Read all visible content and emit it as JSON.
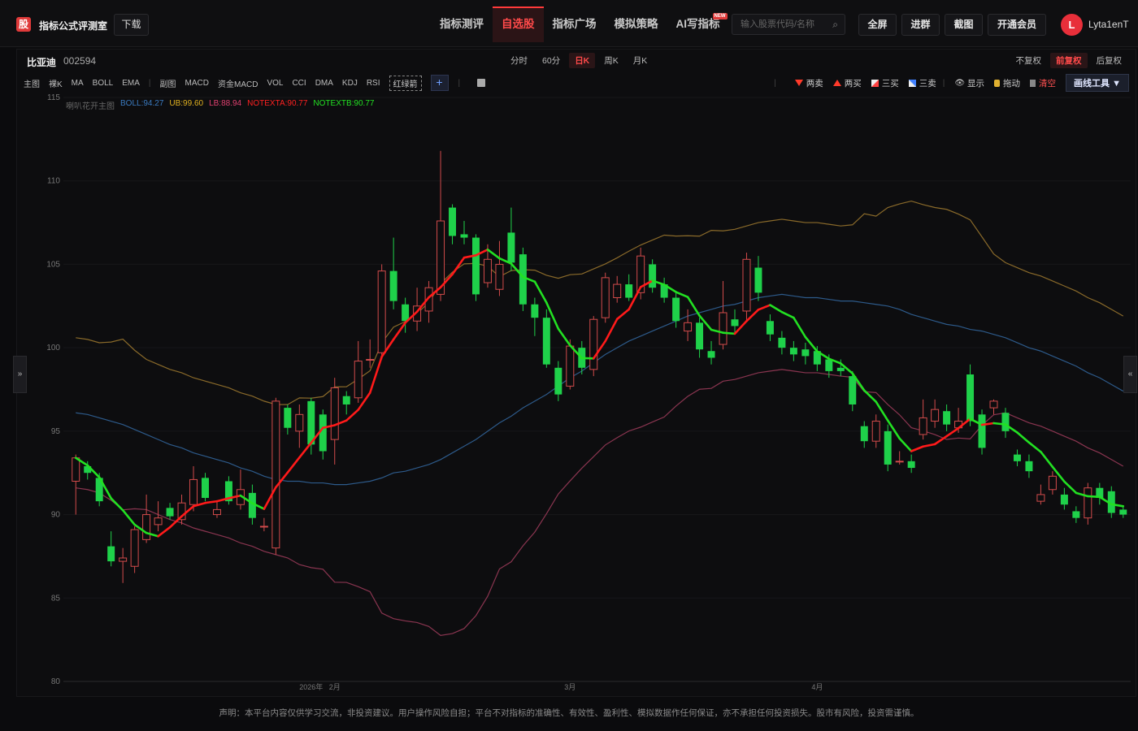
{
  "header": {
    "logo_char": "股",
    "brand": "指标公式评测室",
    "download_label": "下载",
    "nav": [
      {
        "label": "指标测评",
        "active": false
      },
      {
        "label": "自选股",
        "active": true
      },
      {
        "label": "指标广场",
        "active": false
      },
      {
        "label": "模拟策略",
        "active": false
      },
      {
        "label": "AI写指标",
        "active": false,
        "badge": "NEW"
      }
    ],
    "search_placeholder": "输入股票代码/名称",
    "buttons": [
      "全屏",
      "进群",
      "截图",
      "开通会员"
    ],
    "avatar_initial": "L",
    "username": "Lyta1enT"
  },
  "stock": {
    "name": "比亚迪",
    "code": "002594"
  },
  "periods": [
    {
      "label": "分时",
      "active": false
    },
    {
      "label": "60分",
      "active": false
    },
    {
      "label": "日K",
      "active": true
    },
    {
      "label": "周K",
      "active": false
    },
    {
      "label": "月K",
      "active": false
    }
  ],
  "adjusts": [
    {
      "label": "不复权",
      "active": false
    },
    {
      "label": "前复权",
      "active": true
    },
    {
      "label": "后复权",
      "active": false
    }
  ],
  "indicators_main": [
    "主图",
    "裸K",
    "MA",
    "BOLL",
    "EMA"
  ],
  "indicators_sub": [
    "副图",
    "MACD",
    "资金MACD",
    "VOL",
    "CCI",
    "DMA",
    "KDJ",
    "RSI"
  ],
  "indicator_dashed": "红绿箭",
  "tools": {
    "sell2": "两卖",
    "buy2": "两买",
    "buy3": "三买",
    "sell3": "三卖",
    "show": "显示",
    "drag": "拖动",
    "clear": "清空",
    "draw": "画线工具 ▼"
  },
  "legend": {
    "name": "喇叭花开主图",
    "boll": "BOLL:94.27",
    "ub": "UB:99.60",
    "lb": "LB:88.94",
    "notexta": "NOTEXTA:90.77",
    "notextb": "NOTEXTB:90.77"
  },
  "colors": {
    "up": "#d24b4b",
    "down": "#1fd14a",
    "boll": "#2d5a8a",
    "ub": "#8a6a2a",
    "lb": "#8a3550",
    "trend_up": "#ff1a1a",
    "trend_down": "#22e022"
  },
  "footer": "声明：本平台内容仅供学习交流，非投资建议。用户操作风险自担；平台不对指标的准确性、有效性、盈利性、模拟数据作任何保证，亦不承担任何投资损失。股市有风险，投资需谨慎。",
  "chart_data": {
    "type": "candlestick",
    "y_ticks": [
      "115",
      "110",
      "105",
      "100",
      "95",
      "90",
      "85",
      "80"
    ],
    "ylim": [
      80,
      115
    ],
    "x_labels": [
      "2026年",
      "2月",
      "3月",
      "4月"
    ],
    "x_label_index": [
      20,
      22,
      42,
      63
    ],
    "candles": [
      {
        "o": 92.0,
        "c": 93.4,
        "h": 93.6,
        "l": 90.0
      },
      {
        "o": 92.9,
        "c": 92.5,
        "h": 93.2,
        "l": 92.1
      },
      {
        "o": 92.2,
        "c": 90.8,
        "h": 92.5,
        "l": 90.5
      },
      {
        "o": 88.1,
        "c": 87.2,
        "h": 89.0,
        "l": 86.9
      },
      {
        "o": 87.2,
        "c": 87.4,
        "h": 88.0,
        "l": 85.9
      },
      {
        "o": 86.9,
        "c": 89.1,
        "h": 89.3,
        "l": 86.5
      },
      {
        "o": 88.5,
        "c": 90.0,
        "h": 91.2,
        "l": 88.3
      },
      {
        "o": 89.4,
        "c": 89.8,
        "h": 90.8,
        "l": 89.0
      },
      {
        "o": 90.4,
        "c": 89.9,
        "h": 90.7,
        "l": 89.7
      },
      {
        "o": 89.7,
        "c": 90.7,
        "h": 91.2,
        "l": 89.4
      },
      {
        "o": 90.6,
        "c": 92.1,
        "h": 92.9,
        "l": 90.2
      },
      {
        "o": 92.2,
        "c": 91.0,
        "h": 92.5,
        "l": 90.8
      },
      {
        "o": 90.0,
        "c": 90.3,
        "h": 90.8,
        "l": 89.8
      },
      {
        "o": 92.0,
        "c": 90.8,
        "h": 92.3,
        "l": 90.6
      },
      {
        "o": 90.6,
        "c": 91.5,
        "h": 92.7,
        "l": 90.3
      },
      {
        "o": 91.3,
        "c": 89.8,
        "h": 91.8,
        "l": 89.4
      },
      {
        "o": 89.3,
        "c": 89.3,
        "h": 89.8,
        "l": 89.0
      },
      {
        "o": 88.0,
        "c": 96.8,
        "h": 97.0,
        "l": 87.6
      },
      {
        "o": 96.4,
        "c": 95.2,
        "h": 96.6,
        "l": 94.8
      },
      {
        "o": 95.0,
        "c": 96.0,
        "h": 96.6,
        "l": 94.0
      },
      {
        "o": 96.8,
        "c": 94.2,
        "h": 97.0,
        "l": 93.6
      },
      {
        "o": 96.0,
        "c": 93.8,
        "h": 96.3,
        "l": 93.3
      },
      {
        "o": 94.5,
        "c": 97.6,
        "h": 98.2,
        "l": 93.0
      },
      {
        "o": 97.1,
        "c": 96.6,
        "h": 97.4,
        "l": 96.0
      },
      {
        "o": 97.0,
        "c": 99.2,
        "h": 100.4,
        "l": 96.7
      },
      {
        "o": 99.3,
        "c": 99.3,
        "h": 100.5,
        "l": 98.8
      },
      {
        "o": 99.7,
        "c": 104.6,
        "h": 105.0,
        "l": 99.3
      },
      {
        "o": 104.6,
        "c": 102.8,
        "h": 106.6,
        "l": 102.3
      },
      {
        "o": 102.6,
        "c": 101.6,
        "h": 103.0,
        "l": 100.9
      },
      {
        "o": 101.6,
        "c": 102.5,
        "h": 103.6,
        "l": 101.0
      },
      {
        "o": 102.2,
        "c": 103.6,
        "h": 104.0,
        "l": 101.5
      },
      {
        "o": 103.2,
        "c": 107.6,
        "h": 111.8,
        "l": 102.8
      },
      {
        "o": 108.4,
        "c": 106.7,
        "h": 108.6,
        "l": 106.2
      },
      {
        "o": 106.8,
        "c": 106.6,
        "h": 107.6,
        "l": 106.2
      },
      {
        "o": 106.6,
        "c": 103.2,
        "h": 106.8,
        "l": 102.8
      },
      {
        "o": 103.9,
        "c": 105.3,
        "h": 106.2,
        "l": 103.6
      },
      {
        "o": 103.5,
        "c": 105.0,
        "h": 106.4,
        "l": 103.1
      },
      {
        "o": 106.9,
        "c": 105.1,
        "h": 108.4,
        "l": 104.6
      },
      {
        "o": 105.6,
        "c": 102.6,
        "h": 106.0,
        "l": 102.2
      },
      {
        "o": 102.6,
        "c": 101.8,
        "h": 103.0,
        "l": 100.7
      },
      {
        "o": 101.8,
        "c": 99.0,
        "h": 102.3,
        "l": 98.8
      },
      {
        "o": 98.8,
        "c": 97.2,
        "h": 99.2,
        "l": 96.8
      },
      {
        "o": 97.7,
        "c": 100.1,
        "h": 100.5,
        "l": 97.5
      },
      {
        "o": 100.0,
        "c": 98.8,
        "h": 100.4,
        "l": 98.4
      },
      {
        "o": 98.7,
        "c": 101.7,
        "h": 101.9,
        "l": 98.3
      },
      {
        "o": 101.8,
        "c": 104.2,
        "h": 104.5,
        "l": 101.5
      },
      {
        "o": 103.0,
        "c": 103.8,
        "h": 104.3,
        "l": 102.7
      },
      {
        "o": 103.8,
        "c": 103.0,
        "h": 104.4,
        "l": 102.8
      },
      {
        "o": 103.3,
        "c": 105.5,
        "h": 106.0,
        "l": 102.9
      },
      {
        "o": 105.0,
        "c": 103.6,
        "h": 105.3,
        "l": 103.3
      },
      {
        "o": 103.8,
        "c": 103.0,
        "h": 104.2,
        "l": 102.7
      },
      {
        "o": 103.0,
        "c": 101.6,
        "h": 103.4,
        "l": 101.2
      },
      {
        "o": 101.0,
        "c": 101.5,
        "h": 102.3,
        "l": 100.4
      },
      {
        "o": 101.5,
        "c": 99.9,
        "h": 101.8,
        "l": 99.4
      },
      {
        "o": 99.8,
        "c": 99.4,
        "h": 100.4,
        "l": 99.0
      },
      {
        "o": 100.2,
        "c": 102.1,
        "h": 104.0,
        "l": 99.9
      },
      {
        "o": 101.7,
        "c": 101.3,
        "h": 102.3,
        "l": 100.9
      },
      {
        "o": 102.2,
        "c": 105.3,
        "h": 105.7,
        "l": 101.6
      },
      {
        "o": 104.8,
        "c": 103.3,
        "h": 105.5,
        "l": 102.8
      },
      {
        "o": 101.6,
        "c": 100.8,
        "h": 102.0,
        "l": 100.4
      },
      {
        "o": 100.6,
        "c": 100.0,
        "h": 101.0,
        "l": 99.6
      },
      {
        "o": 100.0,
        "c": 99.6,
        "h": 100.4,
        "l": 99.2
      },
      {
        "o": 99.9,
        "c": 99.5,
        "h": 100.3,
        "l": 99.0
      },
      {
        "o": 99.8,
        "c": 99.0,
        "h": 100.1,
        "l": 98.6
      },
      {
        "o": 99.3,
        "c": 98.6,
        "h": 99.6,
        "l": 98.2
      },
      {
        "o": 98.8,
        "c": 98.6,
        "h": 99.3,
        "l": 98.3
      },
      {
        "o": 98.3,
        "c": 96.6,
        "h": 98.6,
        "l": 96.2
      },
      {
        "o": 95.3,
        "c": 94.4,
        "h": 95.6,
        "l": 94.0
      },
      {
        "o": 94.4,
        "c": 95.6,
        "h": 96.0,
        "l": 94.0
      },
      {
        "o": 95.0,
        "c": 93.0,
        "h": 95.4,
        "l": 92.6
      },
      {
        "o": 93.2,
        "c": 93.2,
        "h": 93.8,
        "l": 93.0
      },
      {
        "o": 93.2,
        "c": 92.8,
        "h": 93.6,
        "l": 92.5
      },
      {
        "o": 94.8,
        "c": 95.8,
        "h": 96.9,
        "l": 94.5
      },
      {
        "o": 95.6,
        "c": 96.3,
        "h": 96.9,
        "l": 95.2
      },
      {
        "o": 96.2,
        "c": 95.4,
        "h": 96.6,
        "l": 95.0
      },
      {
        "o": 95.2,
        "c": 95.6,
        "h": 96.4,
        "l": 94.9
      },
      {
        "o": 98.4,
        "c": 95.6,
        "h": 99.0,
        "l": 95.3
      },
      {
        "o": 96.0,
        "c": 94.0,
        "h": 96.3,
        "l": 93.6
      },
      {
        "o": 96.4,
        "c": 96.8,
        "h": 96.9,
        "l": 96.0
      },
      {
        "o": 96.1,
        "c": 95.0,
        "h": 96.4,
        "l": 94.6
      },
      {
        "o": 93.6,
        "c": 93.2,
        "h": 93.9,
        "l": 92.9
      },
      {
        "o": 93.2,
        "c": 92.6,
        "h": 93.6,
        "l": 92.2
      },
      {
        "o": 90.8,
        "c": 91.2,
        "h": 91.8,
        "l": 90.6
      },
      {
        "o": 91.5,
        "c": 92.3,
        "h": 92.6,
        "l": 91.2
      },
      {
        "o": 91.2,
        "c": 90.6,
        "h": 91.6,
        "l": 90.3
      },
      {
        "o": 90.2,
        "c": 89.8,
        "h": 90.5,
        "l": 89.5
      },
      {
        "o": 89.8,
        "c": 91.6,
        "h": 91.9,
        "l": 89.4
      },
      {
        "o": 91.6,
        "c": 91.0,
        "h": 91.9,
        "l": 90.6
      },
      {
        "o": 91.4,
        "c": 90.1,
        "h": 91.7,
        "l": 89.8
      },
      {
        "o": 90.3,
        "c": 90.0,
        "h": 90.5,
        "l": 89.8
      }
    ],
    "boll_mid": [
      96.1,
      96.0,
      95.8,
      95.6,
      95.4,
      95.1,
      94.8,
      94.5,
      94.2,
      94.0,
      93.7,
      93.5,
      93.3,
      93.1,
      92.8,
      92.6,
      92.3,
      92.1,
      92.0,
      92.0,
      91.9,
      91.9,
      91.8,
      91.8,
      91.9,
      92.0,
      92.2,
      92.5,
      92.6,
      92.8,
      93.0,
      93.3,
      93.7,
      94.1,
      94.5,
      95.0,
      95.5,
      95.9,
      96.4,
      96.8,
      97.2,
      97.7,
      98.2,
      98.6,
      99.1,
      99.6,
      100.0,
      100.4,
      100.7,
      101.0,
      101.3,
      101.6,
      101.9,
      102.1,
      102.3,
      102.5,
      102.6,
      102.8,
      103.0,
      103.1,
      103.2,
      103.1,
      103.0,
      103.0,
      102.9,
      102.8,
      102.8,
      102.7,
      102.6,
      102.5,
      102.3,
      102.0,
      101.8,
      101.6,
      101.4,
      101.3,
      101.1,
      101.0,
      100.8,
      100.6,
      100.3,
      100.0,
      99.8,
      99.5,
      99.2,
      98.9,
      98.5,
      98.2,
      97.8,
      97.4,
      97.1,
      96.8,
      96.5,
      96.2,
      95.9,
      95.5,
      95.1,
      94.8,
      94.5,
      94.2,
      93.8
    ]
  }
}
